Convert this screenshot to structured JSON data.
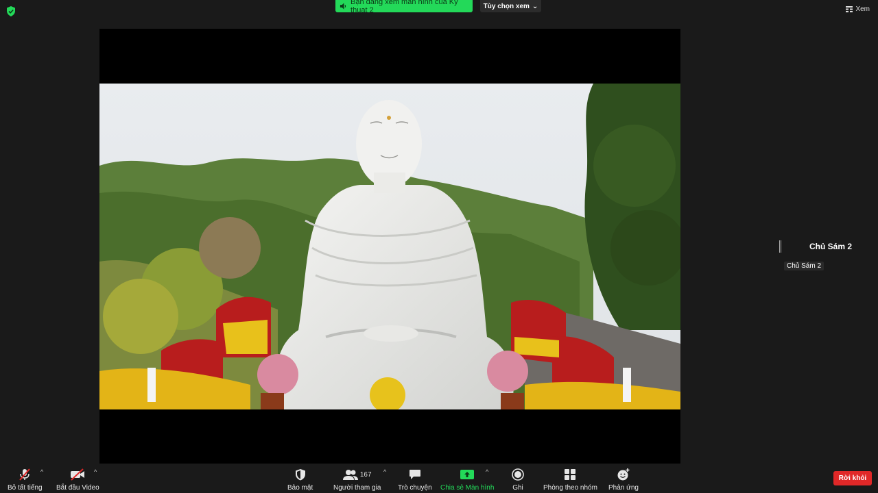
{
  "top": {
    "security_icon": "shield-check-icon",
    "share_banner": "Bạn đang xem màn hình của Ky thuat 2",
    "view_options": "Tùy chọn xem",
    "view_label": "Xem"
  },
  "speaker": {
    "name": "Chủ Sám 2",
    "tag": "Chủ Sám 2"
  },
  "toolbar": {
    "mute": "Bỏ tất tiếng",
    "video": "Bắt đầu Video",
    "security": "Bảo mật",
    "participants": "Người tham gia",
    "participant_count": "167",
    "chat": "Trò chuyện",
    "share": "Chia sẻ Màn hình",
    "record": "Ghi",
    "breakout": "Phòng theo nhóm",
    "reactions": "Phản ứng",
    "leave": "Rời khỏi"
  },
  "colors": {
    "accent_green": "#23d959",
    "leave_red": "#e02828",
    "background": "#1a1a1a"
  }
}
